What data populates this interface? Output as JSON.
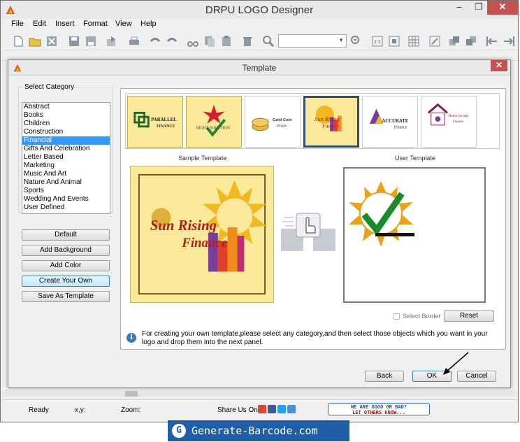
{
  "window": {
    "title": "DRPU LOGO Designer",
    "minimize": "–",
    "maximize": "❐",
    "close": "✕"
  },
  "menu": [
    "File",
    "Edit",
    "Insert",
    "Format",
    "View",
    "Help"
  ],
  "toolbar": {
    "zoom_value": ""
  },
  "dialog": {
    "title": "Template",
    "close": "✕",
    "category_label": "Select Category",
    "categories": [
      "Abstract",
      "Books",
      "Children",
      "Construction",
      "Financial",
      "Gifts And Celebration",
      "Letter Based",
      "Marketing",
      "Music And Art",
      "Nature And Animal",
      "Sports",
      "Wedding And Events",
      "User Defined"
    ],
    "selected_category": "Financial",
    "side_buttons": [
      "Default",
      "Add Background",
      "Add Color",
      "Create Your Own",
      "Save As Template"
    ],
    "templates": [
      {
        "line1": "PARALLEL",
        "line2": "FINANCE"
      },
      {
        "line1": "RIGHT SOLUTION",
        "line2": ""
      },
      {
        "line1": "Gold Coin",
        "line2": "Slogan"
      },
      {
        "line1": "Sun Rising",
        "line2": "Finance"
      },
      {
        "line1": "ACCURATE",
        "line2": "Finance"
      },
      {
        "line1": "Home Savings",
        "line2": "Finance"
      }
    ],
    "selected_template_index": 3,
    "sample_caption": "Sample Template",
    "user_caption": "User Template",
    "sample_logo": {
      "line1": "Sun Rising",
      "line2": "Finance"
    },
    "select_border_label": "Select Border",
    "reset_label": "Reset",
    "info_icon": "i",
    "info_text": "For creating your own template,please select any category,and then select those objects which you want in your logo and drop them into the next panel.",
    "buttons": {
      "back": "Back",
      "ok": "OK",
      "cancel": "Cancel"
    }
  },
  "statusbar": {
    "ready": "Ready",
    "coords": "x,y:",
    "zoom": "Zoom:",
    "share": "Share Us On:",
    "rate_line1": "WE ARE GOOD OR BAD?",
    "rate_line2": "LET OTHERS KNOW..."
  },
  "brand_banner": "Generate-Barcode.com",
  "colors": {
    "accent": "#3399ff",
    "close_red": "#c75050",
    "template_yellow": "#fbe99a",
    "banner_blue": "#1f5fa8"
  }
}
